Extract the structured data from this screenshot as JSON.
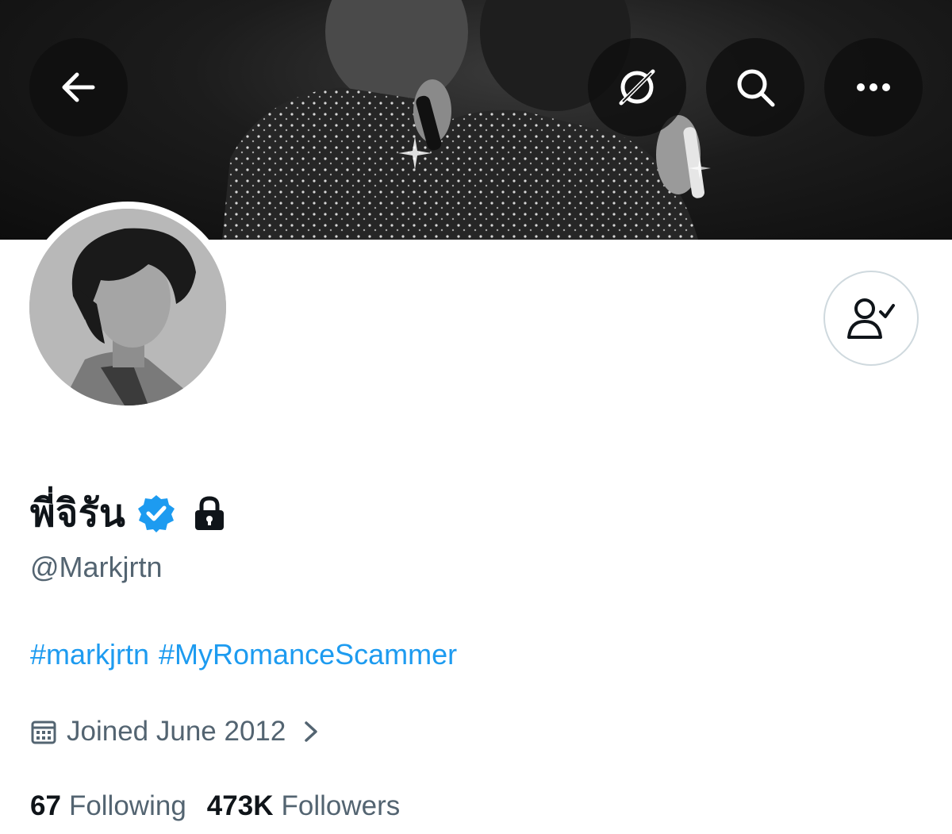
{
  "header": {
    "buttons": [
      {
        "name": "back",
        "icon": "arrow-left-icon"
      },
      {
        "name": "grok",
        "icon": "grok-icon"
      },
      {
        "name": "search",
        "icon": "search-icon"
      },
      {
        "name": "more",
        "icon": "more-dots-icon"
      }
    ]
  },
  "profile": {
    "display_name": "พี่จิรัน",
    "verified": true,
    "verified_color": "#1d9bf0",
    "protected": true,
    "handle": "@Markjrtn",
    "bio_hashtags": [
      "#markjrtn",
      "#MyRomanceScammer"
    ],
    "joined": "Joined June 2012",
    "following_count": "67",
    "following_label": "Following",
    "followers_count": "473K",
    "followers_label": "Followers"
  },
  "actions": {
    "follow_icon": "user-check-icon"
  },
  "colors": {
    "link": "#1d9bf0",
    "secondary_text": "#536471",
    "primary_text": "#0f1419"
  }
}
